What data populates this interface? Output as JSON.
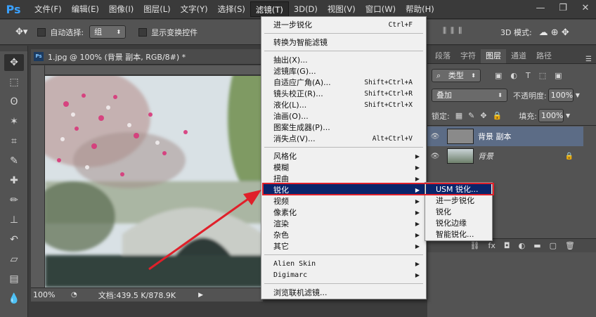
{
  "menubar": {
    "logo": "Ps",
    "items": [
      "文件(F)",
      "编辑(E)",
      "图像(I)",
      "图层(L)",
      "文字(Y)",
      "选择(S)",
      "滤镜(T)",
      "3D(D)",
      "视图(V)",
      "窗口(W)",
      "帮助(H)"
    ],
    "active_index": 6
  },
  "window_controls": {
    "minimize": "—",
    "restore": "❐",
    "close": "✕"
  },
  "options_bar": {
    "auto_select_label": "自动选择:",
    "auto_select_value": "组",
    "show_transform_label": "显示变换控件",
    "mode_label": "3D 模式:"
  },
  "document": {
    "tab_icon": "Ps",
    "title": "1.jpg @ 100% (背景 副本, RGB/8#) *",
    "zoom": "100%",
    "doc_size": "文档:439.5 K/878.9K"
  },
  "filter_menu": {
    "items": [
      {
        "label": "进一步锐化",
        "shortcut": "Ctrl+F"
      },
      {
        "label": "转换为智能滤镜"
      },
      {
        "label": "抽出(X)..."
      },
      {
        "label": "滤镜库(G)..."
      },
      {
        "label": "自适应广角(A)...",
        "shortcut": "Shift+Ctrl+A"
      },
      {
        "label": "镜头校正(R)...",
        "shortcut": "Shift+Ctrl+R"
      },
      {
        "label": "液化(L)...",
        "shortcut": "Shift+Ctrl+X"
      },
      {
        "label": "油画(O)..."
      },
      {
        "label": "图案生成器(P)..."
      },
      {
        "label": "消失点(V)...",
        "shortcut": "Alt+Ctrl+V"
      },
      {
        "label": "风格化",
        "submenu": true
      },
      {
        "label": "模糊",
        "submenu": true
      },
      {
        "label": "扭曲",
        "submenu": true
      },
      {
        "label": "锐化",
        "submenu": true,
        "highlighted": true
      },
      {
        "label": "视频",
        "submenu": true
      },
      {
        "label": "像素化",
        "submenu": true
      },
      {
        "label": "渲染",
        "submenu": true
      },
      {
        "label": "杂色",
        "submenu": true
      },
      {
        "label": "其它",
        "submenu": true
      },
      {
        "label": "Alien Skin",
        "submenu": true
      },
      {
        "label": "Digimarc",
        "submenu": true
      },
      {
        "label": "浏览联机滤镜..."
      }
    ]
  },
  "sharpen_submenu": {
    "items": [
      "USM 锐化...",
      "进一步锐化",
      "锐化",
      "锐化边缘",
      "智能锐化..."
    ],
    "highlighted_index": 0
  },
  "layers_panel": {
    "tabs": [
      "段落",
      "字符",
      "图层",
      "通道",
      "路径"
    ],
    "active_tab": "图层",
    "filter_label": "类型",
    "blend_mode": "叠加",
    "opacity_label": "不透明度:",
    "opacity_value": "100%",
    "lock_label": "锁定:",
    "fill_label": "填充:",
    "fill_value": "100%",
    "layers": [
      {
        "name": "背景 副本",
        "selected": true
      },
      {
        "name": "背景",
        "locked": true
      }
    ]
  },
  "colors": {
    "menu_highlight": "#0a246a",
    "annotation_red": "#e0202a",
    "ps_blue": "#3aa1ff"
  }
}
